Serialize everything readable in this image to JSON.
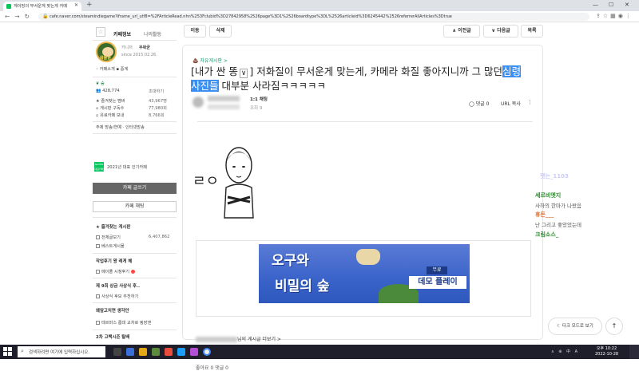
{
  "browser": {
    "tab_title": "게이밍의 무서운게 맞는게 카메",
    "url": "cafe.naver.com/steamindiegame?iframe_url_utf8=%2FArticleRead.nhn%253Fclubid%3D27842958%2526page%3D1%2526boardtype%3DL%2526articleid%3D6245442%2526referrerAllArticles%3Dtrue",
    "newtab_label": "+",
    "window_controls": [
      "—",
      "☐",
      "✕"
    ]
  },
  "sidebar": {
    "tabs": [
      "카페정보",
      "나의활동"
    ],
    "manager_label": "카니저",
    "manager_name": "우왁굳",
    "since": "since 2015.02.26.",
    "cafe_intro": "카페소개",
    "cafe_intro2": "중계",
    "grade_label": "숲",
    "member_count": "428,774",
    "member_invite": "초대하기",
    "stats": [
      {
        "label": "즐겨찾는 멤버",
        "value": "43,967명"
      },
      {
        "label": "게시판 구독수",
        "value": "77,980회"
      },
      {
        "label": "유료카페 보내",
        "value": "8,766회"
      }
    ],
    "tags": "주제  방송/연예 · 인터넷방송",
    "naver_badge": "NAVER 대표카페",
    "award": "2021년 대표 인기카페",
    "write_btn": "카페 글쓰기",
    "chat_btn": "카페 채팅",
    "favorites_title": "즐겨찾는 게시판",
    "favorites": [
      {
        "label": "전체글보기",
        "value": "6,407,862"
      },
      {
        "label": "베스트게시물",
        "value": ""
      }
    ],
    "sections": [
      {
        "title": "작업후기 왕 레게 헤",
        "item": "메이플 시청후기"
      },
      {
        "title": "제 9회 상금 사상식 후..",
        "item": "사상식 후보 추천하기"
      },
      {
        "title": "왜앞고치면 생각안",
        "item": "테르마스 롬데 교차로 핑장앤"
      },
      {
        "title": "2차 고백시즌 탈배",
        "item": ""
      }
    ]
  },
  "main": {
    "top_buttons": {
      "move": "이동",
      "delete": "삭제",
      "prev": "∧ 이전글",
      "next": "∨ 다음글",
      "list": "목록"
    },
    "board_link": "자유게시판 >",
    "title_prefix": "[내가 싼 똥",
    "title_dropdown": "∨",
    "title_part1": "] 저화질이 무서운게 맞는게, 카메라 화질 좋아지니까 그 많던",
    "title_highlight": "심령사진들",
    "title_part2": " 대부분 사라짐ㅋㅋㅋㅋㅋ",
    "author_level": "1:1 채팅",
    "post_views": "조회 9",
    "comment_top": "댓글 0",
    "url_copy": "URL 복사",
    "more": "⋮",
    "banner": {
      "title1": "오구와",
      "title2": "비밀의 숲",
      "free": "무료",
      "demo": "데모 플레이"
    },
    "author_posts_suffix": "님의 게시글 더보기 >",
    "bottom_actions": "좋아요 0   댓글 0"
  },
  "right_panel": {
    "chats": [
      {
        "name": "잿는_1103",
        "color": "#c9c9ff"
      },
      {
        "name": "세르비엣지",
        "color": "#2a8a2a"
      },
      {
        "name": "사하의 한마가 나왔음",
        "color": "#555",
        "sub": true
      },
      {
        "name": "휴든___",
        "color": "#e06a2a"
      },
      {
        "name": "난 그리고 좋았었는데",
        "color": "#555",
        "sub": true
      },
      {
        "name": "크림소스_",
        "color": "#2a8a2a"
      }
    ],
    "darkmode": "다크 모드로 보기",
    "totop": "↑"
  },
  "taskbar": {
    "search_placeholder": "검색하려면 여기에 입력하십시오.",
    "time": "오후 10:22",
    "date": "2022-10-28",
    "tray": "∧ ⊕ 中 A"
  }
}
